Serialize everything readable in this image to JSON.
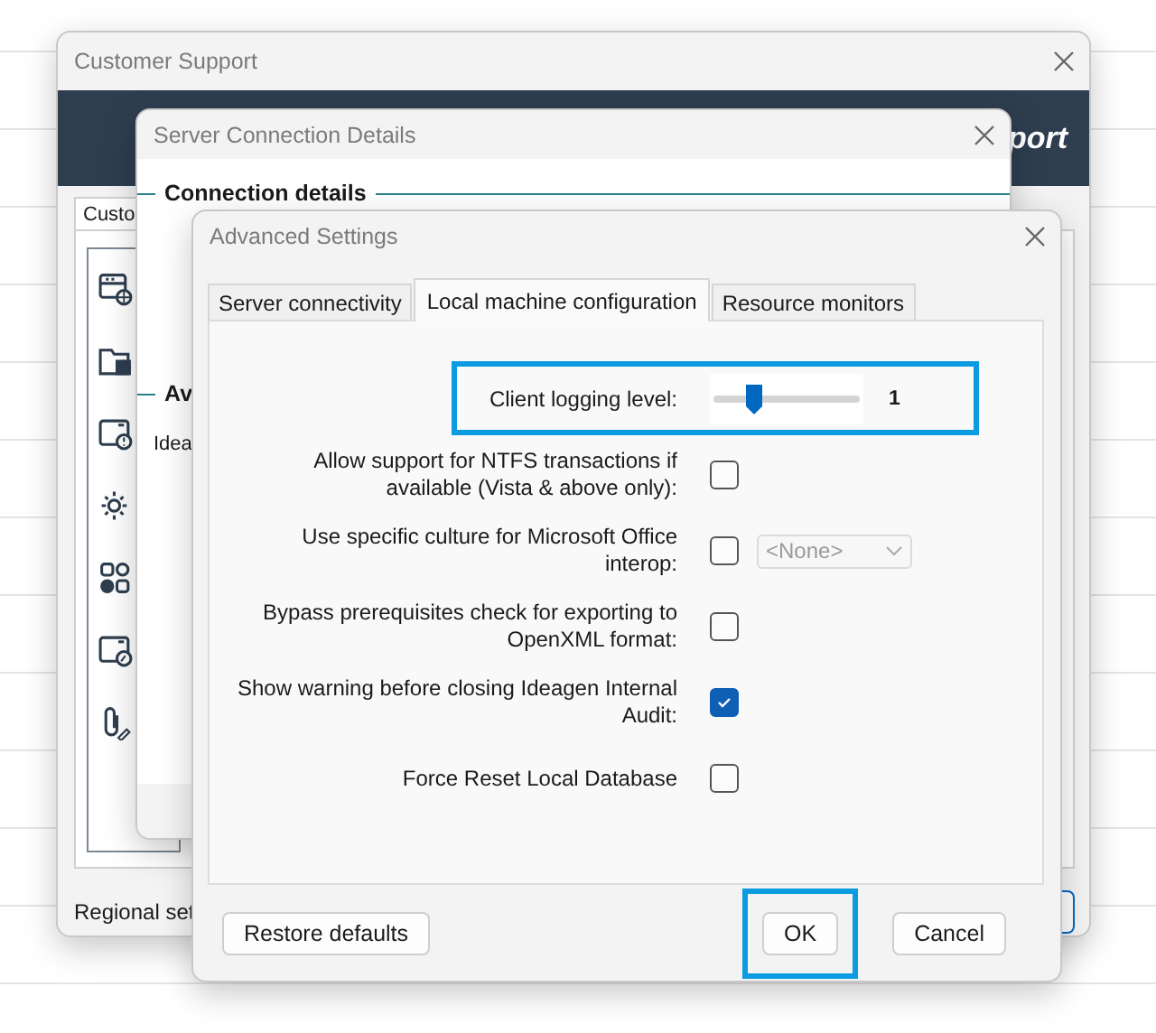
{
  "customer_support_window": {
    "title": "Customer Support",
    "banner_text": "port",
    "tab": "Custo",
    "footer_text": "Regional set"
  },
  "server_connection_window": {
    "title": "Server Connection Details",
    "section_heading": "Connection details",
    "second_heading": "Av",
    "body_text": "Idea"
  },
  "advanced_settings_window": {
    "title": "Advanced Settings",
    "tabs": [
      {
        "label": "Server connectivity",
        "selected": false
      },
      {
        "label": "Local machine configuration",
        "selected": true
      },
      {
        "label": "Resource monitors",
        "selected": false
      }
    ],
    "settings": [
      {
        "kind": "slider",
        "label": "Client logging level:",
        "level": 0.27,
        "reading": "1",
        "highlighted": true
      },
      {
        "kind": "checkbox",
        "label": "Allow support for NTFS transactions if available (Vista & above only):",
        "checked": false
      },
      {
        "kind": "checkbox_dropdown",
        "label": "Use specific culture for Microsoft Office interop:",
        "checked": false,
        "dropdown": {
          "value": "<None>",
          "disabled": true
        }
      },
      {
        "kind": "checkbox",
        "label": "Bypass prerequisites check for exporting to OpenXML format:",
        "checked": false
      },
      {
        "kind": "checkbox",
        "label": "Show warning before closing Ideagen Internal Audit:",
        "checked": true
      },
      {
        "kind": "checkbox",
        "label": "Force Reset Local Database",
        "checked": false
      }
    ],
    "buttons": [
      {
        "label": "Restore defaults",
        "highlighted": false
      },
      {
        "label": "OK",
        "highlighted": true
      },
      {
        "label": "Cancel",
        "highlighted": false
      }
    ]
  }
}
